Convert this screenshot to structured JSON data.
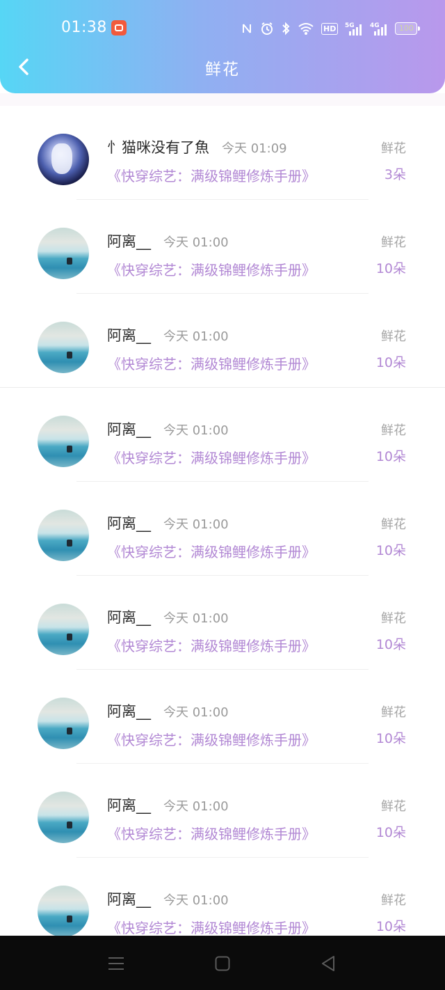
{
  "status_bar": {
    "time": "01:38",
    "hd_label": "HD",
    "net_5g": "5G",
    "net_4g": "4G",
    "battery": "100"
  },
  "header": {
    "title": "鲜花",
    "back_icon": "chevron-left-icon"
  },
  "colors": {
    "header_gradient": [
      "#56d6f5",
      "#8fb0f2",
      "#b998ec"
    ],
    "accent_purple": "#b288d4",
    "muted_gray": "#9a9a9a"
  },
  "items": [
    {
      "avatar": "anime",
      "name": "忄猫咪没有了魚",
      "time": "今天 01:09",
      "book": "《快穿综艺：满级锦鲤修炼手册》",
      "gift": "鲜花",
      "count": "3朵"
    },
    {
      "avatar": "sea",
      "name": "阿离__",
      "time": "今天 01:00",
      "book": "《快穿综艺：满级锦鲤修炼手册》",
      "gift": "鲜花",
      "count": "10朵"
    },
    {
      "avatar": "sea",
      "name": "阿离__",
      "time": "今天 01:00",
      "book": "《快穿综艺：满级锦鲤修炼手册》",
      "gift": "鲜花",
      "count": "10朵"
    },
    {
      "avatar": "sea",
      "name": "阿离__",
      "time": "今天 01:00",
      "book": "《快穿综艺：满级锦鲤修炼手册》",
      "gift": "鲜花",
      "count": "10朵"
    },
    {
      "avatar": "sea",
      "name": "阿离__",
      "time": "今天 01:00",
      "book": "《快穿综艺：满级锦鲤修炼手册》",
      "gift": "鲜花",
      "count": "10朵"
    },
    {
      "avatar": "sea",
      "name": "阿离__",
      "time": "今天 01:00",
      "book": "《快穿综艺：满级锦鲤修炼手册》",
      "gift": "鲜花",
      "count": "10朵"
    },
    {
      "avatar": "sea",
      "name": "阿离__",
      "time": "今天 01:00",
      "book": "《快穿综艺：满级锦鲤修炼手册》",
      "gift": "鲜花",
      "count": "10朵"
    },
    {
      "avatar": "sea",
      "name": "阿离__",
      "time": "今天 01:00",
      "book": "《快穿综艺：满级锦鲤修炼手册》",
      "gift": "鲜花",
      "count": "10朵"
    },
    {
      "avatar": "sea",
      "name": "阿离__",
      "time": "今天 01:00",
      "book": "《快穿综艺：满级锦鲤修炼手册》",
      "gift": "鲜花",
      "count": "10朵"
    }
  ],
  "nav_bar": {
    "icons": [
      "menu-icon",
      "home-square-icon",
      "back-triangle-icon"
    ]
  }
}
